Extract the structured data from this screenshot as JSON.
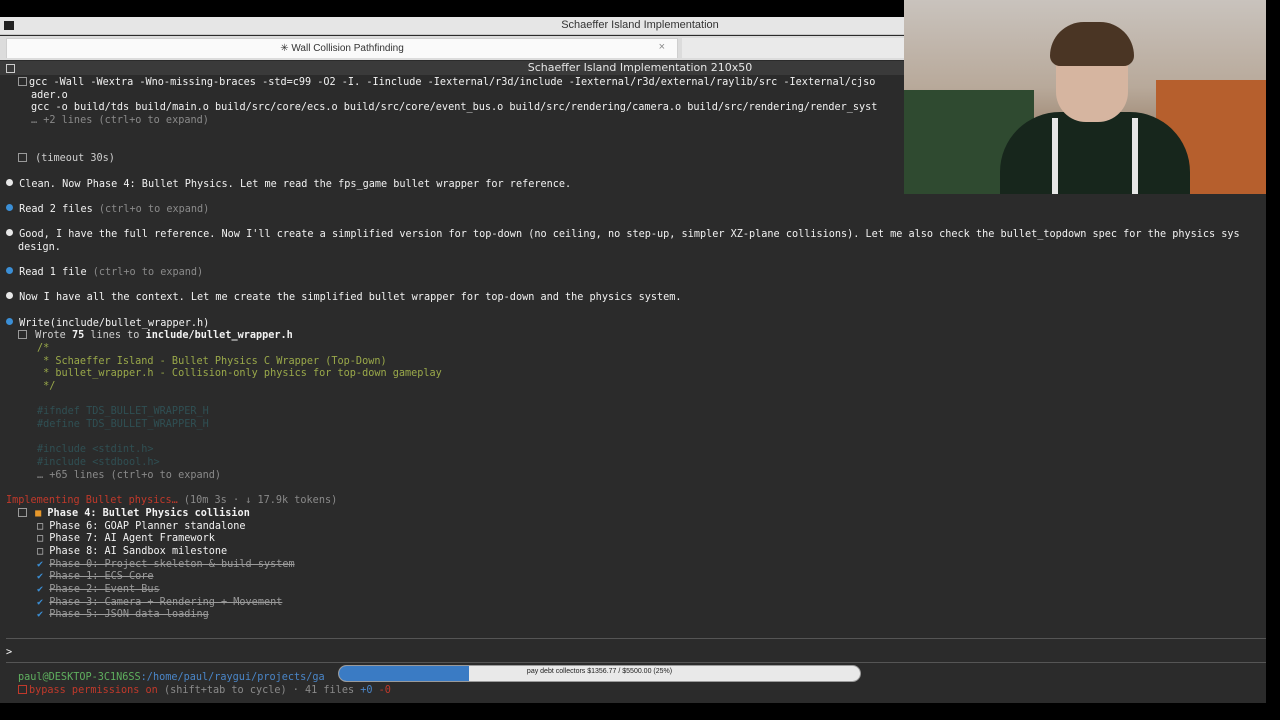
{
  "window": {
    "title": "Schaeffer Island Implementation"
  },
  "tabs": [
    {
      "label": "✳ Wall Collision Pathfinding",
      "close": "×"
    }
  ],
  "terminal": {
    "title": "Schaeffer Island Implementation 210x50",
    "lines": {
      "l1": "gcc -Wall -Wextra -Wno-missing-braces -std=c99 -O2 -I. -Iinclude -Iexternal/r3d/include -Iexternal/r3d/external/raylib/src -Iexternal/cjso",
      "l2": "ader.o",
      "l3": "gcc -o build/tds build/main.o build/src/core/ecs.o build/src/core/event_bus.o build/src/rendering/camera.o build/src/rendering/render_syst",
      "l4": "… +2 lines (ctrl+o to expand)",
      "l5": "(timeout 30s)",
      "l6": "Clean. Now Phase 4: Bullet Physics. Let me read the fps_game bullet wrapper for reference.",
      "l7a": "Read 2 files",
      "l7b": " (ctrl+o to expand)",
      "l8": "Good, I have the full reference. Now I'll create a simplified version for top-down (no ceiling, no step-up, simpler XZ-plane collisions). Let me also check the bullet_topdown spec for the physics sys",
      "l9": "design.",
      "l10a": "Read 1 file",
      "l10b": " (ctrl+o to expand)",
      "l11": "Now I have all the context. Let me create the simplified bullet wrapper for top-down and the physics system.",
      "l12": "Write(include/bullet_wrapper.h)",
      "l13a": "Wrote ",
      "l13b": "75",
      "l13c": " lines to ",
      "l13d": "include/bullet_wrapper.h",
      "c1": "/*",
      "c2": " * Schaeffer Island - Bullet Physics C Wrapper (Top-Down)",
      "c3": " * bullet_wrapper.h - Collision-only physics for top-down gameplay",
      "c4": " */",
      "c5": "#ifndef TDS_BULLET_WRAPPER_H",
      "c6": "#define TDS_BULLET_WRAPPER_H",
      "c7": "#include <stdint.h>",
      "c8": "#include <stdbool.h>",
      "l14": "… +65 lines (ctrl+o to expand)",
      "l15a": "Implementing Bullet physics…",
      "l15b": " (10m 3s · ↓ 17.9k tokens)"
    },
    "todos": [
      {
        "status": "active",
        "label": "Phase 4: Bullet Physics collision"
      },
      {
        "status": "pending",
        "label": "Phase 6: GOAP Planner standalone"
      },
      {
        "status": "pending",
        "label": "Phase 7: AI Agent Framework"
      },
      {
        "status": "pending",
        "label": "Phase 8: AI Sandbox milestone"
      },
      {
        "status": "done",
        "label": "Phase 0: Project skeleton & build system"
      },
      {
        "status": "done",
        "label": "Phase 1: ECS Core"
      },
      {
        "status": "done",
        "label": "Phase 2: Event Bus"
      },
      {
        "status": "done",
        "label": "Phase 3: Camera + Rendering + Movement"
      },
      {
        "status": "done",
        "label": "Phase 5: JSON data loading"
      }
    ],
    "prompt_symbol": ">",
    "status": {
      "path_user": "paul@DESKTOP-3C1N6SS",
      "path_dir": ":/home/paul/raygui/projects/ga",
      "perm_a": "bypass permissions on",
      "perm_b": " (shift+tab to cycle) · 41 files ",
      "perm_c": "+0",
      "perm_d": " -0"
    }
  },
  "overlay_progress": {
    "text": "pay debt collectors $1356.77 / $5500.00 (25%)",
    "fraction": 0.25
  },
  "colors": {
    "accent_blue": "#3b8fd6",
    "active_orange": "#e7982b",
    "comment_green": "#9aa94a",
    "error_red": "#c0392b"
  }
}
